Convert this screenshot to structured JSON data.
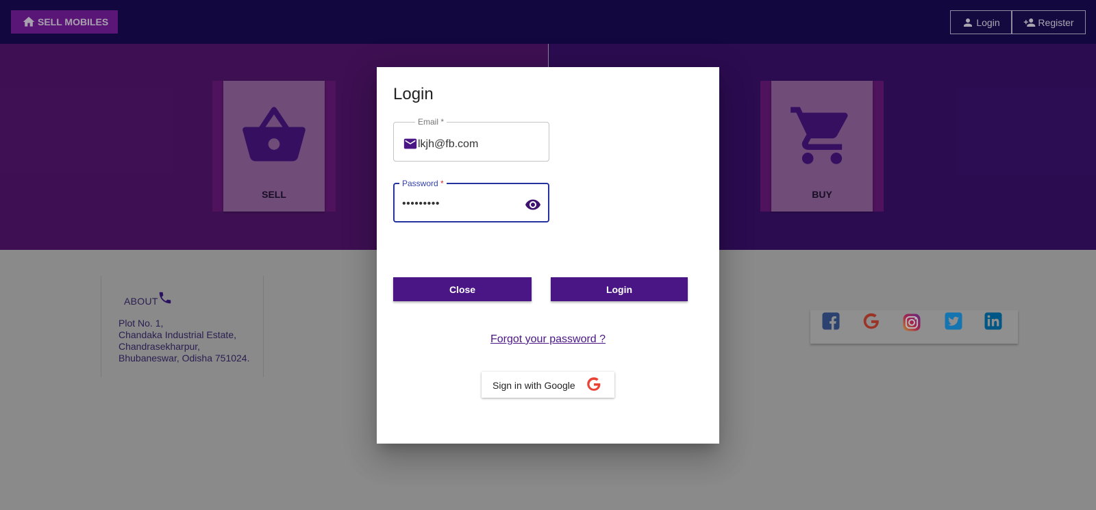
{
  "header": {
    "brand_label": "SELL MOBILES",
    "login_label": "Login",
    "register_label": "Register"
  },
  "hero": {
    "sell_label": "SELL",
    "buy_label": "BUY"
  },
  "about": {
    "title": "ABOUT",
    "address_lines": [
      "Plot No. 1,",
      "Chandaka Industrial Estate,",
      "Chandrasekharpur,",
      "Bhubaneswar, Odisha 751024."
    ]
  },
  "social": {
    "icons": [
      "facebook-icon",
      "google-icon",
      "instagram-icon",
      "twitter-icon",
      "linkedin-icon"
    ]
  },
  "dialog": {
    "title": "Login",
    "email_label": "Email",
    "email_required": " *",
    "email_value": "lkjh@fb.com",
    "password_label": "Password",
    "password_required": " *",
    "password_value": "•••••••••",
    "close_label": "Close",
    "login_label": "Login",
    "forgot_label": "Forgot your password ?",
    "google_label": "Sign in with Google"
  },
  "colors": {
    "primary": "#4a1585",
    "header_bg": "#1a0a55",
    "brand_button": "#7b1fa2"
  }
}
